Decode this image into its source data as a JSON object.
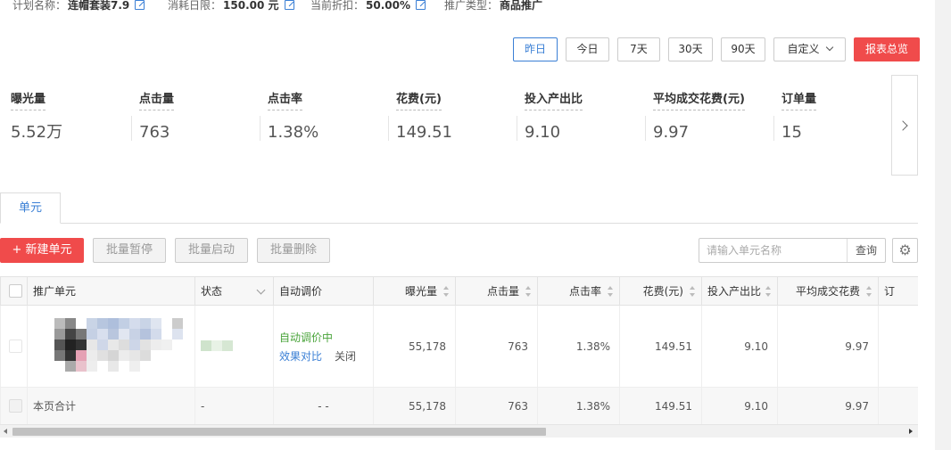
{
  "plan": {
    "name_label": "计划名称：",
    "name_value": "连帽套装7.9",
    "budget_label": "消耗日限：",
    "budget_value": "150.00 元",
    "discount_label": "当前折扣：",
    "discount_value": "50.00%",
    "type_label": "推广类型：",
    "type_value": "商品推广"
  },
  "date_range": {
    "buttons": [
      "昨日",
      "今日",
      "7天",
      "30天",
      "90天"
    ],
    "active": "昨日",
    "custom_label": "自定义",
    "report_label": "报表总览"
  },
  "metrics": [
    {
      "label": "曝光量",
      "value": "5.52万"
    },
    {
      "label": "点击量",
      "value": "763"
    },
    {
      "label": "点击率",
      "value": "1.38%"
    },
    {
      "label": "花费(元)",
      "value": "149.51"
    },
    {
      "label": "投入产出比",
      "value": "9.10"
    },
    {
      "label": "平均成交花费(元)",
      "value": "9.97"
    },
    {
      "label": "订单量",
      "value": "15"
    }
  ],
  "tabs": [
    {
      "label": "单元"
    }
  ],
  "toolbar": {
    "new_unit": "+ 新建单元",
    "batch_pause": "批量暂停",
    "batch_start": "批量启动",
    "batch_delete": "批量删除",
    "search_placeholder": "请输入单元名称",
    "search_button": "查询"
  },
  "table": {
    "columns": [
      "推广单元",
      "状态",
      "自动调价",
      "曝光量",
      "点击量",
      "点击率",
      "花费(元)",
      "投入产出比",
      "平均成交花费",
      "订"
    ],
    "row": {
      "auto_bid_status": "自动调价中",
      "compare_link": "效果对比",
      "close_link": "关闭",
      "impressions": "55,178",
      "clicks": "763",
      "ctr": "1.38%",
      "cost": "149.51",
      "roi": "9.10",
      "avg_cost": "9.97"
    },
    "total": {
      "label": "本页合计",
      "status": "-",
      "auto_bid": "- -",
      "impressions": "55,178",
      "clicks": "763",
      "ctr": "1.38%",
      "cost": "149.51",
      "roi": "9.10",
      "avg_cost": "9.97"
    }
  },
  "colors": {
    "accent": "#3a7fd5",
    "primary_red": "#f04b4b",
    "success_green": "#4aa43b"
  }
}
